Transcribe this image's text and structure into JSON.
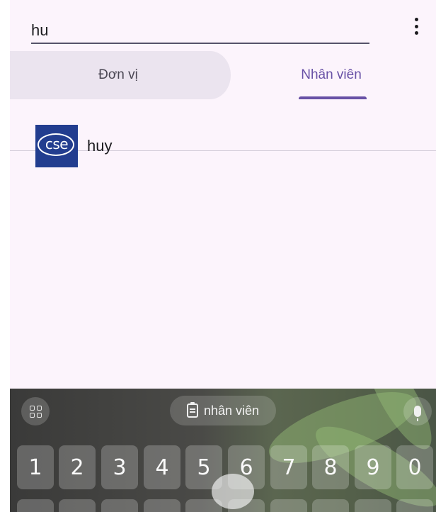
{
  "search": {
    "value": "hu"
  },
  "tabs": [
    {
      "label": "Đơn vị",
      "active": false
    },
    {
      "label": "Nhân viên",
      "active": true
    }
  ],
  "results": [
    {
      "name": "huy",
      "avatar_text": "cse"
    }
  ],
  "keyboard": {
    "suggestion": "nhân viên",
    "number_keys": [
      "1",
      "2",
      "3",
      "4",
      "5",
      "6",
      "7",
      "8",
      "9",
      "0"
    ]
  },
  "icons": {
    "more": "more-vert-icon",
    "grid": "apps-grid-icon",
    "clipboard": "clipboard-icon",
    "mic": "microphone-icon"
  },
  "colors": {
    "accent": "#6851a6",
    "background": "#fcf4fc",
    "avatar": "#223d8f"
  }
}
